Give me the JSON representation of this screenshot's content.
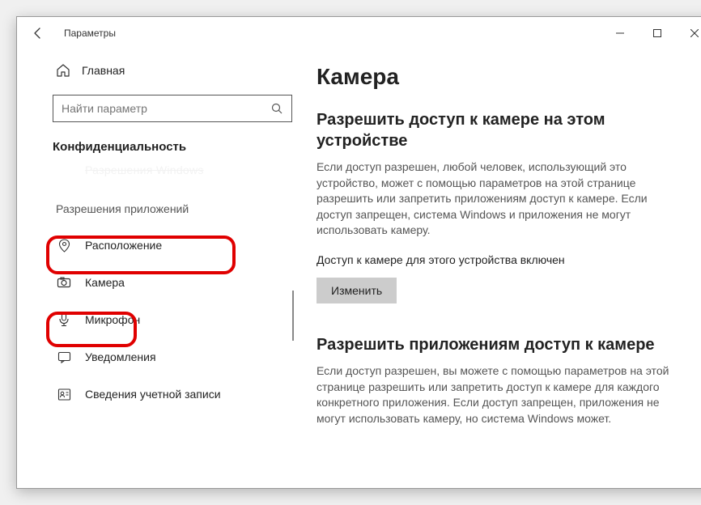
{
  "window": {
    "title": "Параметры"
  },
  "sidebar": {
    "home": "Главная",
    "search_placeholder": "Найти параметр",
    "category": "Конфиденциальность",
    "section_header": "Разрешения приложений",
    "items": {
      "faded": "Разрешения Windows",
      "location": "Расположение",
      "camera": "Камера",
      "microphone": "Микрофон",
      "notifications": "Уведомления",
      "account": "Сведения учетной записи"
    }
  },
  "content": {
    "title": "Камера",
    "section1_title": "Разрешить доступ к камере на этом устройстве",
    "section1_text": "Если доступ разрешен, любой человек, использующий это устройство, может с помощью параметров на этой странице разрешить или запретить приложениям доступ к камере. Если доступ запрещен, система Windows и приложения не могут использовать камеру.",
    "status": "Доступ к камере для этого устройства включен",
    "change_button": "Изменить",
    "section2_title": "Разрешить приложениям доступ к камере",
    "section2_text": "Если доступ разрешен, вы можете с помощью параметров на этой странице разрешить или запретить доступ к камере для каждого конкретного приложения. Если доступ запрещен, приложения не могут использовать камеру, но система Windows может."
  }
}
